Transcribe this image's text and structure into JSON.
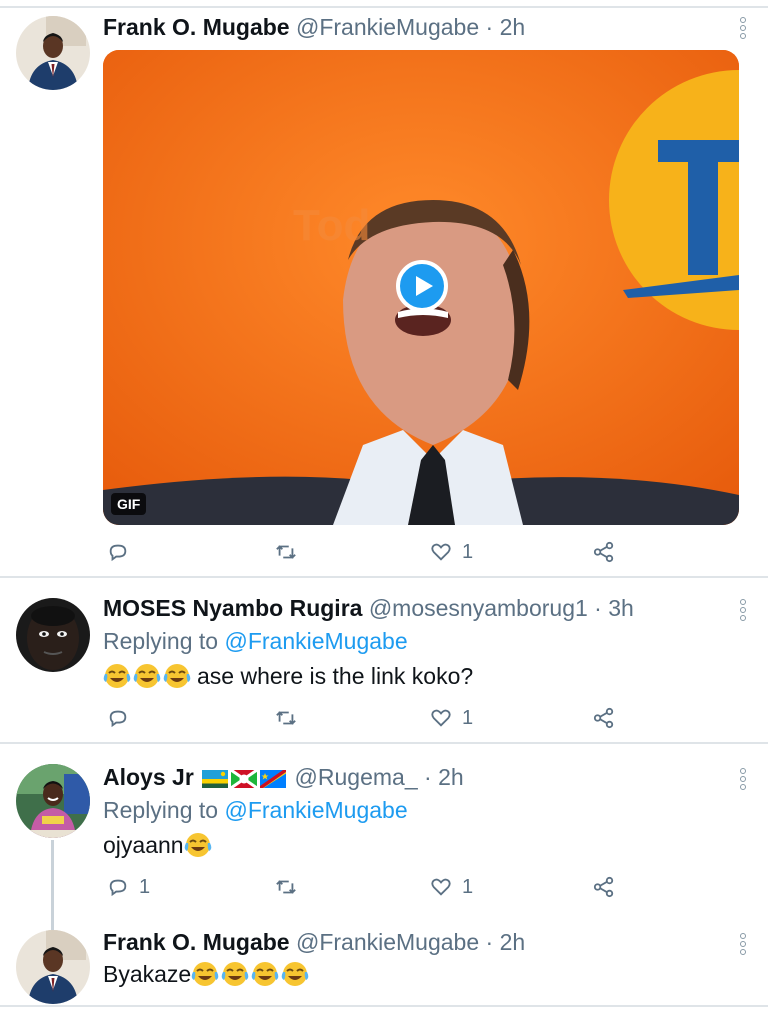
{
  "tweets": [
    {
      "name": "Frank O. Mugabe",
      "handle": "@FrankieMugabe",
      "time": "· 2h",
      "media_badge": "GIF",
      "actions": {
        "reply": "",
        "retweet": "",
        "like": "1",
        "share": ""
      }
    },
    {
      "name": "MOSES Nyambo Rugira",
      "handle": "@mosesnyamborug1",
      "time": "· 3h",
      "reply_prefix": "Replying to ",
      "reply_to": "@FrankieMugabe",
      "text": "ase where is the link koko?",
      "emoji_count": 3,
      "actions": {
        "reply": "",
        "retweet": "",
        "like": "1",
        "share": ""
      }
    },
    {
      "name": "Aloys Jr",
      "handle": "@Rugema_",
      "time": "· 2h",
      "reply_prefix": "Replying to ",
      "reply_to": "@FrankieMugabe",
      "text": "ojyaann",
      "actions": {
        "reply": "1",
        "retweet": "",
        "like": "1",
        "share": ""
      }
    },
    {
      "name": "Frank O. Mugabe",
      "handle": "@FrankieMugabe",
      "time": "· 2h",
      "text": "Byakaze",
      "emoji_count": 4
    }
  ],
  "icons": {
    "reply": "reply-icon",
    "retweet": "retweet-icon",
    "like": "heart-icon",
    "share": "share-icon",
    "more": "more-vertical-icon",
    "play": "play-icon",
    "emoji": "face-with-tears-of-joy-emoji"
  },
  "colors": {
    "link": "#1d9bf0",
    "secondary_text": "#5b7083",
    "divider": "#dfe4e8",
    "thread_line": "#c9d2d9",
    "media_background": "#f26a10"
  }
}
